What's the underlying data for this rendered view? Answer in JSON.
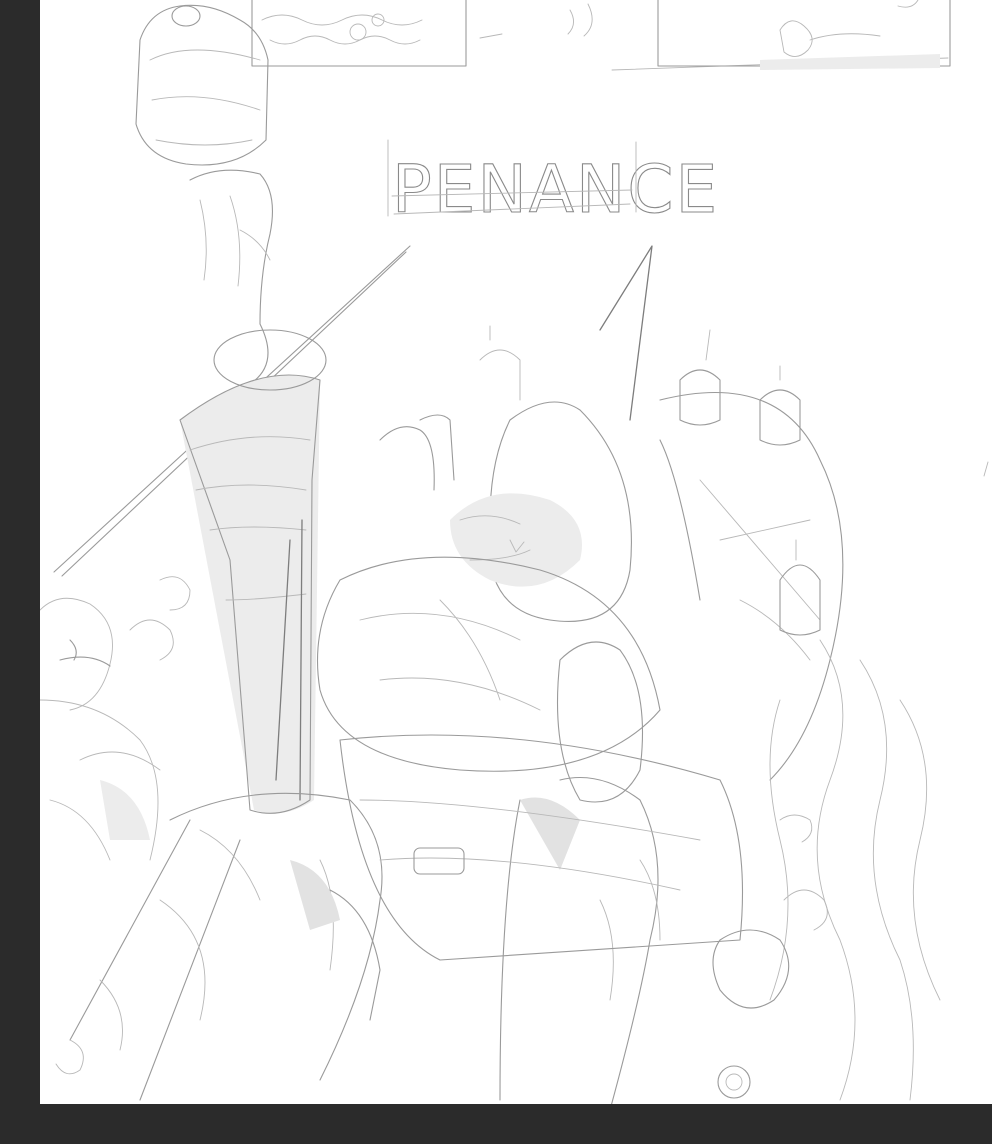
{
  "artwork": {
    "title_lettering": "PENANCE"
  }
}
